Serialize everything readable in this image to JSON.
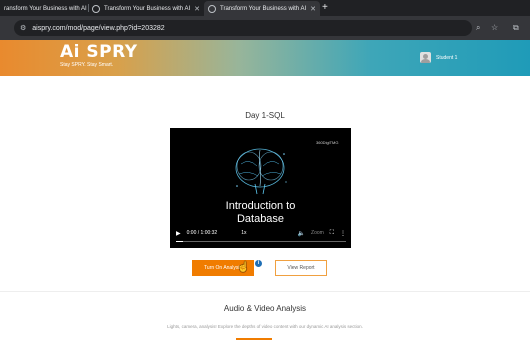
{
  "browser": {
    "tabs": [
      {
        "title": "ransform Your Business with AI"
      },
      {
        "title": "Transform Your Business with AI"
      },
      {
        "title": "Transform Your Business with AI"
      }
    ],
    "address": "aispry.com/mod/page/view.php?id=203282"
  },
  "header": {
    "logo": "Ai SPRY",
    "tagline": "Stay SPRY. Stay Smart.",
    "user_name": "Student 1",
    "gradient_colors": [
      "#e98a2e",
      "#98b59a",
      "#1f9bb8"
    ]
  },
  "lesson": {
    "title": "Day 1-SQL"
  },
  "video": {
    "brand": "360DigiTMG",
    "title_line1": "Introduction to",
    "title_line2": "Database",
    "time": "0:00 / 1:00:32",
    "speed": "1x",
    "watermark": "Zoom",
    "progress_fraction": 0.04
  },
  "buttons": {
    "turn_on_analysis": "Turn On Analysis",
    "view_report": "View Report",
    "accent_color": "#f07c00"
  },
  "section": {
    "title": "Audio & Video Analysis",
    "description": "Lights, camera, analysis! Explore the depths of video content with our dynamic AI analysis section."
  }
}
